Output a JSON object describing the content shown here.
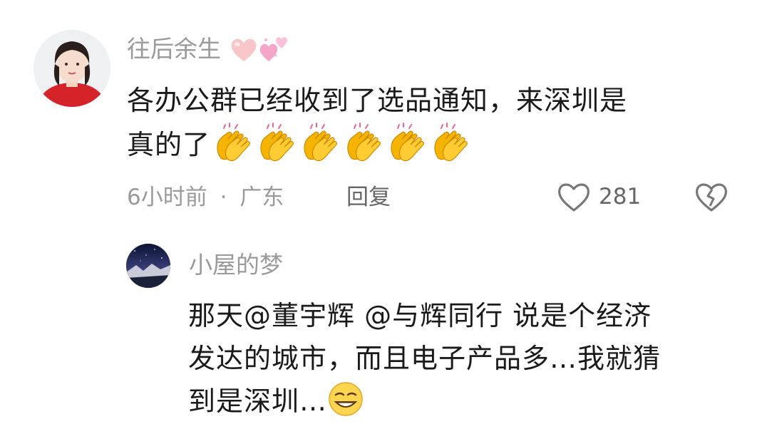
{
  "comment": {
    "author": "往后余生",
    "text_line1": "各办公群已经收到了选品通知，来深圳是",
    "text_line2": "真的了",
    "time": "6小时前",
    "separator": "·",
    "location": "广东",
    "reply_label": "回复",
    "like_count": "281",
    "clap_emoji_count": 6,
    "name_emojis": [
      "pink-heart-icon",
      "two-hearts-icon"
    ],
    "colors": {
      "name": "#9a9a9a",
      "text": "#1a1a1a",
      "meta": "#9a9a9a"
    }
  },
  "reply": {
    "author": "小屋的梦",
    "text_line1": "那天@董宇辉 @与辉同行 说是个经济",
    "text_line2": "发达的城市，而且电子产品多…我就猜",
    "text_line3": "到是深圳…",
    "emoji": "smirk-face-icon"
  }
}
